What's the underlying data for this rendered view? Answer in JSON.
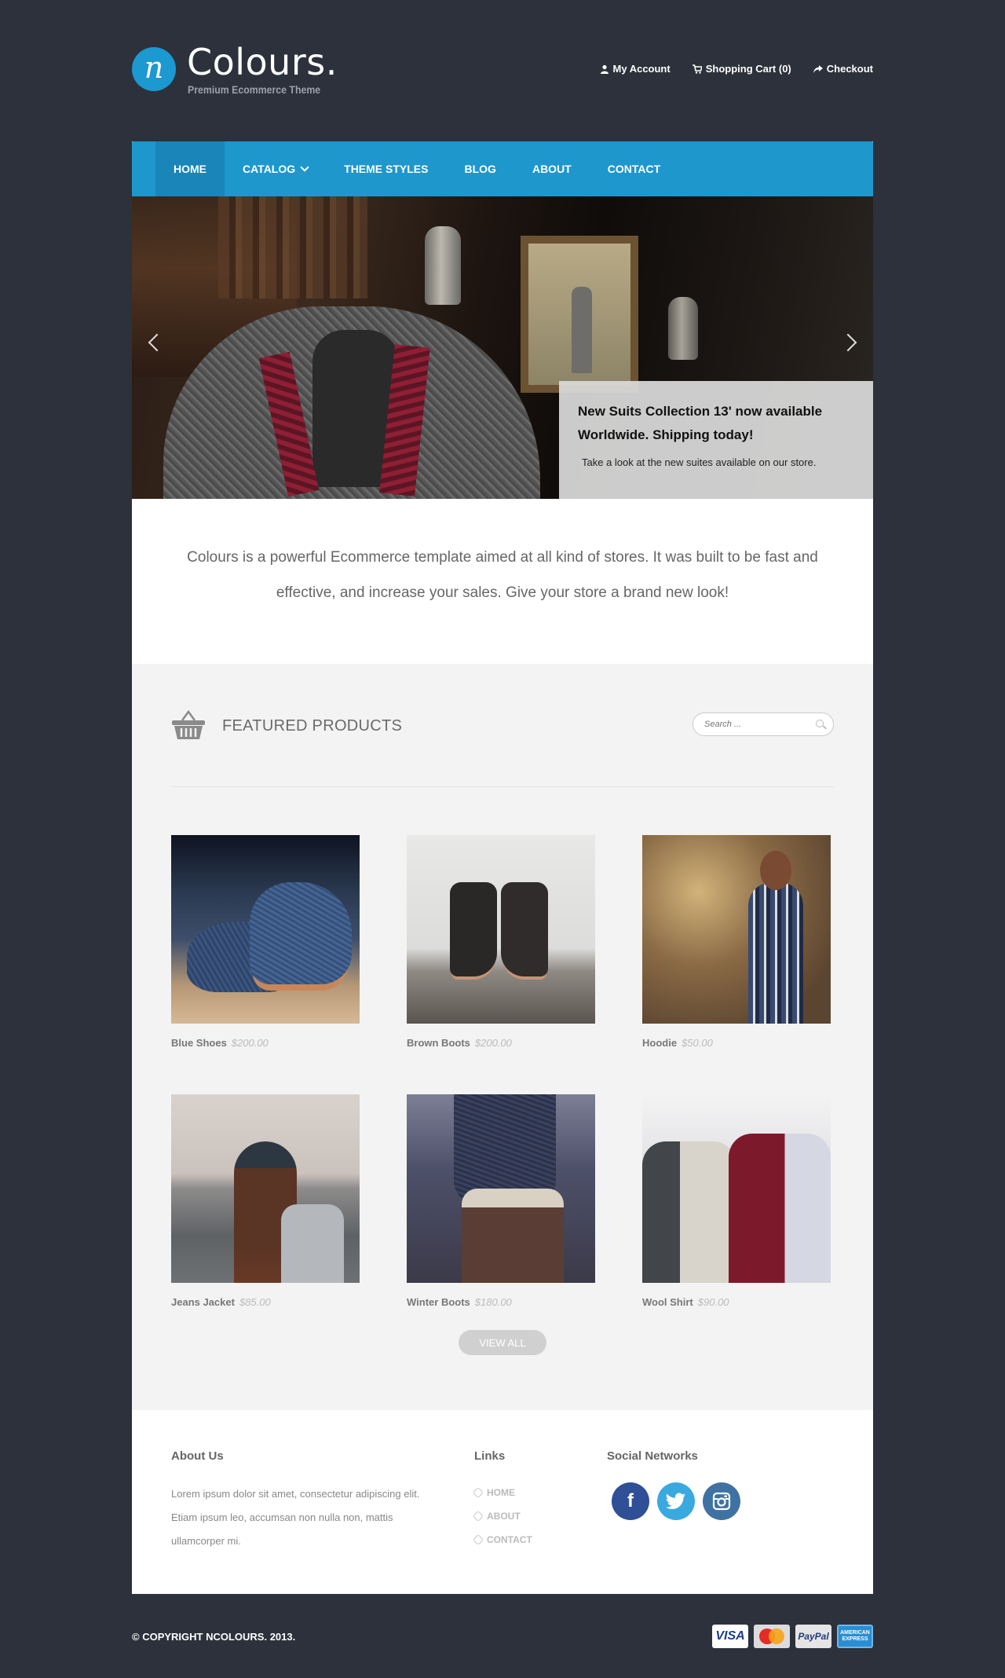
{
  "header": {
    "logo_letter": "n",
    "brand": "Colours.",
    "tagline": "Premium Ecommerce Theme",
    "links": [
      {
        "label": "My Account",
        "icon": "user-icon"
      },
      {
        "label": "Shopping Cart (0)",
        "icon": "cart-icon"
      },
      {
        "label": "Checkout",
        "icon": "share-arrow-icon"
      }
    ]
  },
  "nav": {
    "items": [
      {
        "label": "HOME",
        "active": true
      },
      {
        "label": "CATALOG",
        "has_dropdown": true
      },
      {
        "label": "THEME STYLES"
      },
      {
        "label": "BLOG"
      },
      {
        "label": "ABOUT"
      },
      {
        "label": "CONTACT"
      }
    ]
  },
  "slider": {
    "caption_title": "New Suits Collection 13' now available Worldwide. Shipping today!",
    "caption_text": "Take a look at the new suites available on our store."
  },
  "intro": {
    "text": "Colours is a powerful Ecommerce template aimed at all kind of stores. It was built to be fast and effective, and increase your sales. Give your store a brand new look!"
  },
  "featured": {
    "title": "FEATURED PRODUCTS",
    "search_placeholder": "Search ...",
    "products": [
      {
        "name": "Blue Shoes",
        "price": "$200.00"
      },
      {
        "name": "Brown Boots",
        "price": "$200.00"
      },
      {
        "name": "Hoodie",
        "price": "$50.00"
      },
      {
        "name": "Jeans Jacket",
        "price": "$85.00"
      },
      {
        "name": "Winter Boots",
        "price": "$180.00"
      },
      {
        "name": "Wool Shirt",
        "price": "$90.00"
      }
    ],
    "view_all": "VIEW ALL"
  },
  "footer": {
    "about_title": "About Us",
    "about_text": "Lorem ipsum dolor sit amet, consectetur adipiscing elit. Etiam ipsum leo, accumsan non nulla non, mattis ullamcorper mi.",
    "links_title": "Links",
    "links": [
      "HOME",
      "ABOUT",
      "CONTACT"
    ],
    "social_title": "Social Networks",
    "socials": [
      "facebook-icon",
      "twitter-icon",
      "instagram-icon"
    ]
  },
  "bottom": {
    "copyright": "© COPYRIGHT NCOLOURS. 2013.",
    "cards": {
      "visa": "VISA",
      "mastercard": "MasterCard",
      "paypal": "PayPal",
      "amex": "AMERICAN EXPRESS"
    }
  },
  "colors": {
    "background": "#2c313b",
    "accent": "#1e97cd",
    "accent_dark": "#1a85b8"
  }
}
